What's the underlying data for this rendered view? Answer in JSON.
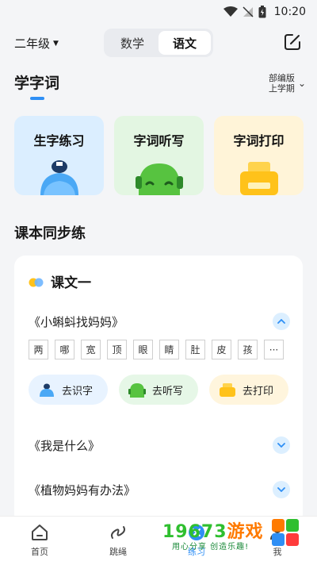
{
  "status": {
    "time": "10:20"
  },
  "header": {
    "grade": "二年级",
    "subjects": [
      "数学",
      "语文"
    ],
    "active_subject": "语文"
  },
  "study": {
    "title": "学字词",
    "edition_line1": "部编版",
    "edition_line2": "上学期",
    "cards": [
      {
        "label": "生字练习"
      },
      {
        "label": "字词听写"
      },
      {
        "label": "字词打印"
      }
    ]
  },
  "sync": {
    "title": "课本同步练",
    "lesson_title": "课文一",
    "texts": [
      {
        "title": "《小蝌蚪找妈妈》",
        "expanded": true
      },
      {
        "title": "《我是什么》",
        "expanded": false
      },
      {
        "title": "《植物妈妈有办法》",
        "expanded": false
      }
    ],
    "chars": [
      "两",
      "哪",
      "宽",
      "顶",
      "眼",
      "睛",
      "肚",
      "皮",
      "孩",
      "···"
    ],
    "actions": [
      "去识字",
      "去听写",
      "去打印"
    ]
  },
  "nav": {
    "items": [
      {
        "label": "首页"
      },
      {
        "label": "跳绳"
      },
      {
        "label": "练习"
      },
      {
        "label": "我"
      }
    ],
    "active": "练习"
  },
  "watermark": {
    "title_green": "19673",
    "title_orange": "游戏",
    "subtitle": "用心分享 创造乐趣!"
  },
  "colors": {
    "accent": "#2f8ff5",
    "blue_card": "#dbeeff",
    "green_card": "#e3f6e2",
    "yellow_card": "#fff4d8"
  }
}
